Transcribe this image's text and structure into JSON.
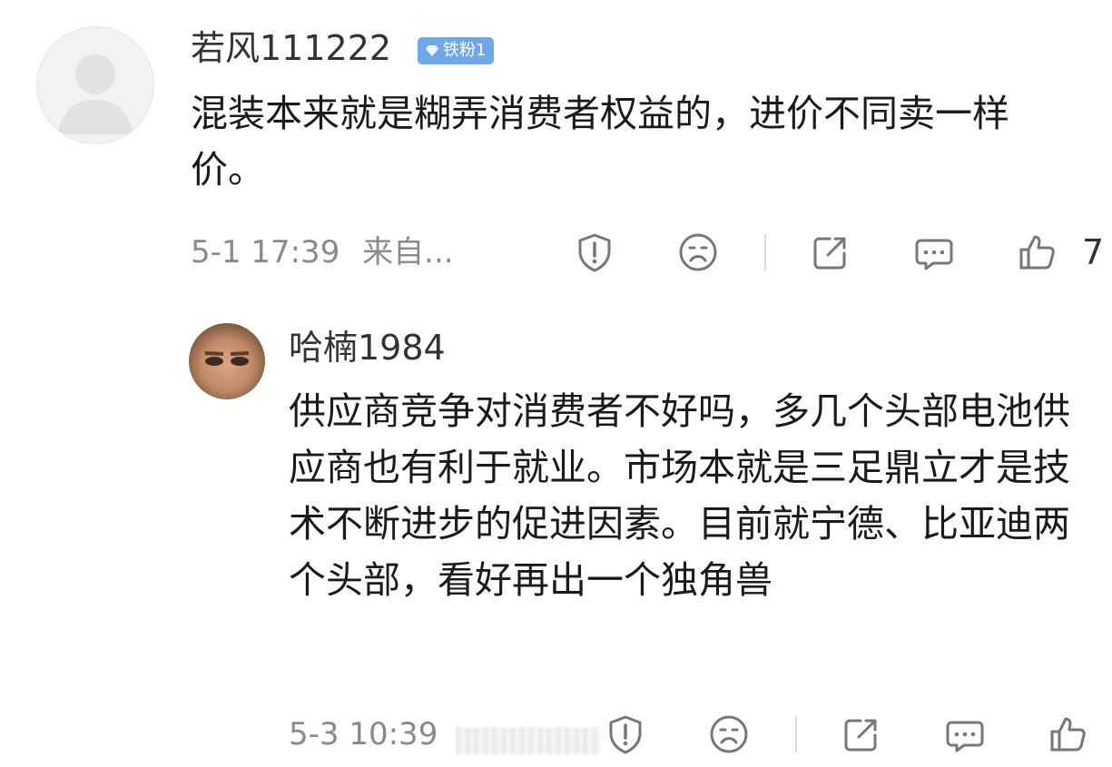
{
  "comment1": {
    "username": "若风111222",
    "badge": "铁粉1",
    "text": "混装本来就是糊弄消费者权益的，进价不同卖一样价。",
    "time": "5-1 17:39",
    "source": "来自...",
    "like_count": "7"
  },
  "comment2": {
    "username": "哈楠1984",
    "text": "供应商竞争对消费者不好吗，多几个头部电池供应商也有利于就业。市场本就是三足鼎立才是技术不断进步的促进因素。目前就宁德、比亚迪两个头部，看好再出一个独角兽",
    "time": "5-3 10:39"
  },
  "icons": {
    "report": "report-shield-icon",
    "dislike": "sad-face-icon",
    "share": "share-icon",
    "reply": "comment-bubble-icon",
    "like": "thumbs-up-icon"
  },
  "colors": {
    "text": "#1a1a1a",
    "meta": "#8a8a8a",
    "badge": "#6fa8e7"
  }
}
